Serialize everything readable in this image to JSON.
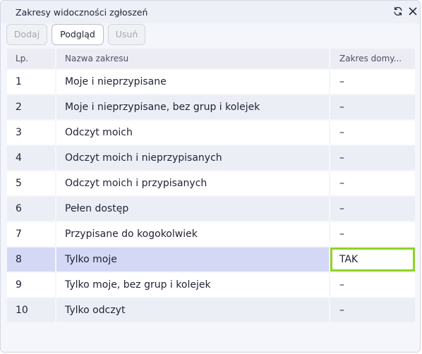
{
  "window": {
    "title": "Zakresy widoczności zgłoszeń",
    "icons": [
      "refresh-icon",
      "close-icon"
    ]
  },
  "toolbar": {
    "add_label": "Dodaj",
    "preview_label": "Podgląd",
    "delete_label": "Usuń"
  },
  "table": {
    "headers": [
      "Lp.",
      "Nazwa zakresu",
      "Zakres domy..."
    ],
    "rows": [
      {
        "lp": "1",
        "name": "Moje i nieprzypisane",
        "default": "–"
      },
      {
        "lp": "2",
        "name": "Moje i nieprzypisane, bez grup i kolejek",
        "default": "–"
      },
      {
        "lp": "3",
        "name": "Odczyt moich",
        "default": "–"
      },
      {
        "lp": "4",
        "name": "Odczyt moich i nieprzypisanych",
        "default": "–"
      },
      {
        "lp": "5",
        "name": "Odczyt moich i przypisanych",
        "default": "–"
      },
      {
        "lp": "6",
        "name": "Pełen dostęp",
        "default": "–"
      },
      {
        "lp": "7",
        "name": "Przypisane do kogokolwiek",
        "default": "–"
      },
      {
        "lp": "8",
        "name": "Tylko moje",
        "default": "TAK"
      },
      {
        "lp": "9",
        "name": "Tylko moje, bez grup i kolejek",
        "default": "–"
      },
      {
        "lp": "10",
        "name": "Tylko odczyt",
        "default": "–"
      }
    ],
    "selected_row": 8
  },
  "colors": {
    "selected_row": "#d5d8f5",
    "focus_border": "#8fd327",
    "stripe": "#eceef6"
  }
}
